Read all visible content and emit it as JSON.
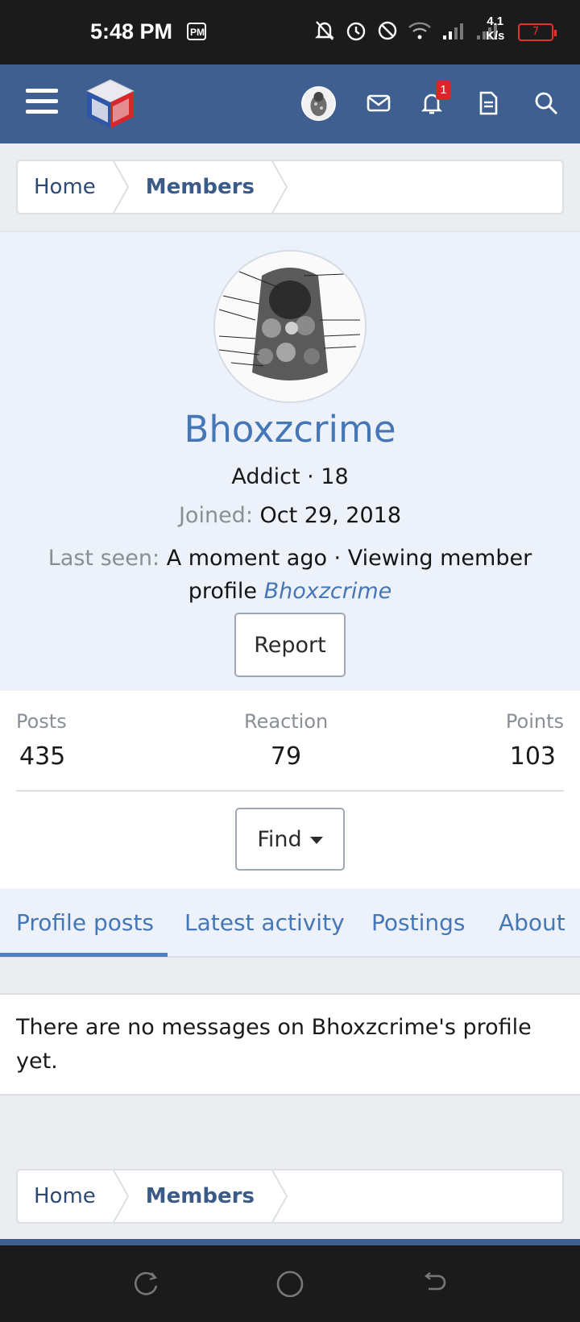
{
  "status_bar": {
    "time": "5:48 PM",
    "speed_value": "4.1",
    "speed_unit": "K/s",
    "battery": "7",
    "icons": [
      "pm-icon",
      "bell-off-icon",
      "alarm-icon",
      "dnd-icon",
      "wifi-icon",
      "signal-icon",
      "signal-icon"
    ]
  },
  "header": {
    "notification_count": "1",
    "icons": [
      "hamburger-menu-icon",
      "site-logo",
      "user-avatar",
      "inbox-icon",
      "bell-icon",
      "document-icon",
      "search-icon"
    ]
  },
  "breadcrumb": {
    "items": [
      "Home",
      "Members"
    ]
  },
  "profile": {
    "username": "Bhoxzcrime",
    "user_title": "Addict · 18",
    "joined_label": "Joined:",
    "joined_value": "Oct 29, 2018",
    "last_seen_label": "Last seen:",
    "last_seen_value": "A moment ago · Viewing member profile",
    "last_seen_link": "Bhoxzcrime",
    "report_label": "Report"
  },
  "stats": {
    "posts_label": "Posts",
    "posts_value": "435",
    "reaction_label": "Reaction",
    "reaction_value": "79",
    "points_label": "Points",
    "points_value": "103",
    "find_label": "Find"
  },
  "tabs": {
    "items": [
      "Profile posts",
      "Latest activity",
      "Postings",
      "About"
    ],
    "active_index": 0
  },
  "messages": {
    "empty_text": "There are no messages on Bhoxzcrime's profile yet."
  },
  "colors": {
    "header_bg": "#3e5f8f",
    "link_blue": "#4576b5",
    "badge_red": "#d8262b"
  }
}
